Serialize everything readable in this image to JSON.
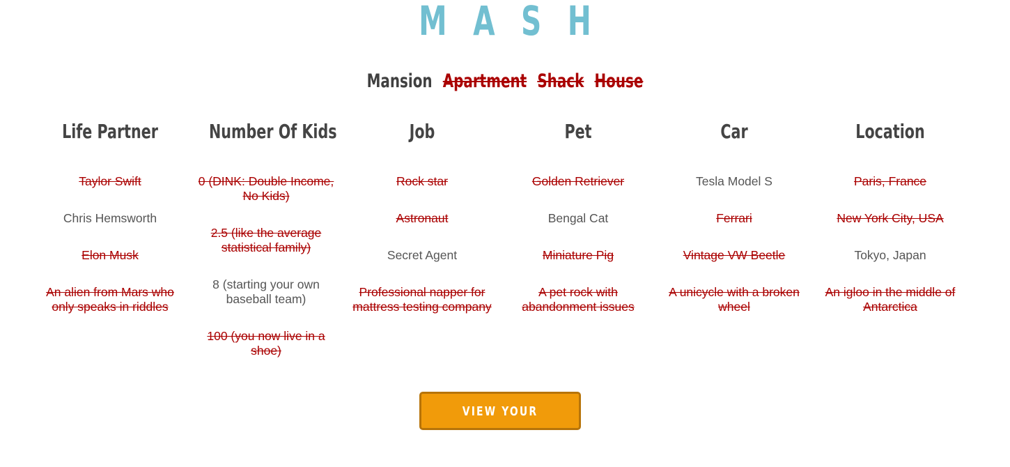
{
  "title": "MASH",
  "housing": [
    {
      "label": "Mansion",
      "struck": false
    },
    {
      "label": "Apartment",
      "struck": true
    },
    {
      "label": "Shack",
      "struck": true
    },
    {
      "label": "House",
      "struck": true
    }
  ],
  "categories": [
    {
      "title": "Life Partner",
      "options": [
        {
          "label": "Taylor Swift",
          "struck": true
        },
        {
          "label": "Chris Hemsworth",
          "struck": false
        },
        {
          "label": "Elon Musk",
          "struck": true
        },
        {
          "label": "An alien from Mars who only speaks in riddles",
          "struck": true
        }
      ]
    },
    {
      "title": "Number Of Kids",
      "options": [
        {
          "label": "0 (DINK: Double Income, No Kids)",
          "struck": true
        },
        {
          "label": "2.5 (like the average statistical family)",
          "struck": true
        },
        {
          "label": "8 (starting your own baseball team)",
          "struck": false
        },
        {
          "label": "100 (you now live in a shoe)",
          "struck": true
        }
      ]
    },
    {
      "title": "Job",
      "options": [
        {
          "label": "Rock star",
          "struck": true
        },
        {
          "label": "Astronaut",
          "struck": true
        },
        {
          "label": "Secret Agent",
          "struck": false
        },
        {
          "label": "Professional napper for mattress testing company",
          "struck": true
        }
      ]
    },
    {
      "title": "Pet",
      "options": [
        {
          "label": "Golden Retriever",
          "struck": true
        },
        {
          "label": "Bengal Cat",
          "struck": false
        },
        {
          "label": "Miniature Pig",
          "struck": true
        },
        {
          "label": "A pet rock with abandonment issues",
          "struck": true
        }
      ]
    },
    {
      "title": "Car",
      "options": [
        {
          "label": "Tesla Model S",
          "struck": false
        },
        {
          "label": "Ferrari",
          "struck": true
        },
        {
          "label": "Vintage VW Beetle",
          "struck": true
        },
        {
          "label": "A unicycle with a broken wheel",
          "struck": true
        }
      ]
    },
    {
      "title": "Location",
      "options": [
        {
          "label": "Paris, France",
          "struck": true
        },
        {
          "label": "New York City, USA",
          "struck": true
        },
        {
          "label": "Tokyo, Japan",
          "struck": false
        },
        {
          "label": "An igloo in the middle of Antarctica",
          "struck": true
        }
      ]
    }
  ],
  "fortune_button": {
    "label": "VIEW YOUR FORTUNE"
  },
  "colors": {
    "title": "#72bfd1",
    "struck": "#aa0000",
    "button_bg": "#f19b0a",
    "button_border": "#b7740a"
  }
}
